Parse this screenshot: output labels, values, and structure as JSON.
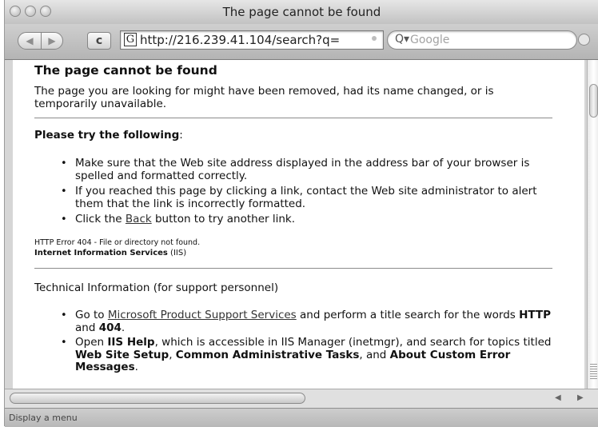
{
  "window": {
    "title": "The page cannot be found"
  },
  "toolbar": {
    "back_label": "◀",
    "forward_label": "▶",
    "reload_label": "c",
    "favicon_letter": "G",
    "url": "http://216.239.41.104/search?q=",
    "search_glyph": "Q▾",
    "search_placeholder": "Google"
  },
  "page": {
    "heading": "The page cannot be found",
    "intro": "The page you are looking for might have been removed, had its name changed, or is temporarily unavailable.",
    "try_heading": "Please try the following",
    "try_heading_suffix": ":",
    "bullets": {
      "b1": "Make sure that the Web site address displayed in the address bar of your browser is spelled and formatted correctly.",
      "b2": "If you reached this page by clicking a link, contact the Web site administrator to alert them that the link is incorrectly formatted.",
      "b3_pre": "Click the ",
      "b3_link": "Back",
      "b3_post": " button to try another link."
    },
    "error_line": "HTTP Error 404 - File or directory not found.",
    "iis_bold": "Internet Information Services",
    "iis_suffix": " (IIS)",
    "tech_heading": "Technical Information (for support personnel)",
    "tech": {
      "t1_pre": "Go to ",
      "t1_link": "Microsoft Product Support Services",
      "t1_mid": " and perform a title search for the words ",
      "t1_b1": "HTTP",
      "t1_and": " and ",
      "t1_b2": "404",
      "t1_end": ".",
      "t2_pre": "Open ",
      "t2_b1": "IIS Help",
      "t2_mid": ", which is accessible in IIS Manager (inetmgr), and search for topics titled ",
      "t2_b2": "Web Site Setup",
      "t2_comma": ", ",
      "t2_b3": "Common Administrative Tasks",
      "t2_and": ", and ",
      "t2_b4": "About Custom Error Messages",
      "t2_end": "."
    }
  },
  "status": {
    "text": "Display a menu"
  },
  "scrollbar": {
    "left_arrow": "◀",
    "right_arrow": "▶"
  }
}
